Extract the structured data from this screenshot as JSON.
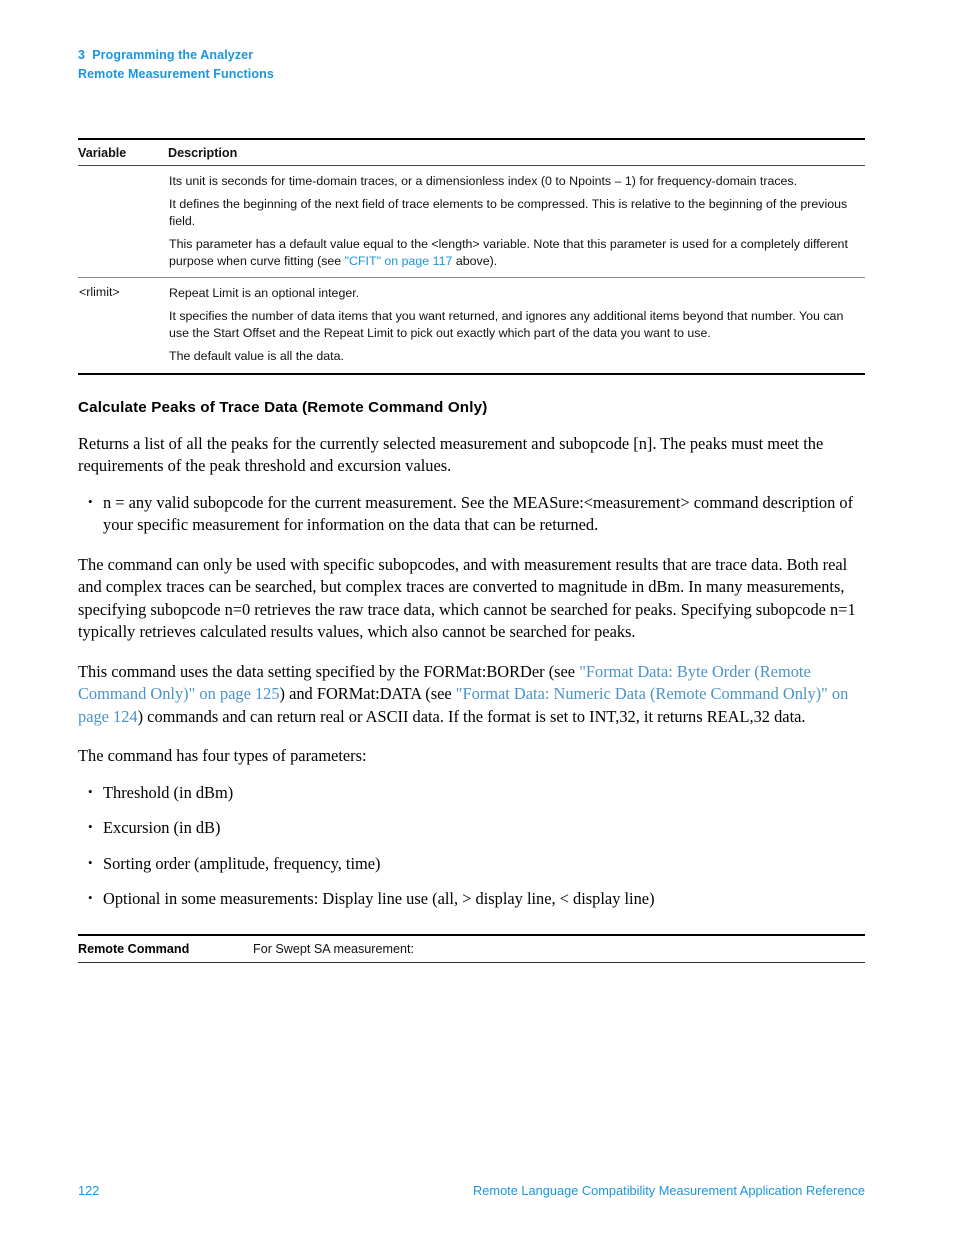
{
  "header": {
    "chapter_line": "3  Programming the Analyzer",
    "section_line": "Remote Measurement Functions"
  },
  "variable_table": {
    "columns": {
      "variable": "Variable",
      "description": "Description"
    },
    "rows": [
      {
        "variable": "",
        "paragraphs": [
          "Its unit is seconds for time-domain traces, or a dimensionless index (0 to Npoints – 1) for frequency-domain traces.",
          "It defines the beginning of the next field of trace elements to be compressed. This is relative to the beginning of the previous field."
        ],
        "link_paragraph": {
          "before": "This parameter has a default value equal to the <length> variable. Note that this parameter is used for a completely different purpose when curve fitting (see ",
          "link": "\"CFIT\" on page 117",
          "after": " above)."
        }
      },
      {
        "variable": "<rlimit>",
        "paragraphs": [
          "Repeat Limit is an optional integer.",
          "It specifies the number of data items that you want returned, and ignores any additional items beyond that number. You can use the Start Offset and the Repeat Limit to pick out exactly which part of the data you want to use.",
          "The default value is all the data."
        ]
      }
    ]
  },
  "section": {
    "heading": "Calculate Peaks of Trace Data (Remote Command Only)",
    "intro": "Returns a list of all the peaks for the currently selected measurement and subopcode [n]. The peaks must meet the requirements of the peak threshold and excursion values.",
    "intro_bullets": [
      "n = any valid subopcode for the current measurement. See the MEASure:<measurement> command description of your specific measurement for information on the data that can be returned."
    ],
    "paragraph_subopcodes": "The command can only be used with specific subopcodes, and with measurement results that are trace data. Both real and complex traces can be searched, but complex traces are converted to magnitude in dBm. In many measurements, specifying subopcode n=0 retrieves the raw trace data, which cannot be searched for peaks. Specifying subopcode n=1 typically retrieves calculated results values, which also cannot be searched for peaks.",
    "paragraph_format": {
      "part1": "This command uses the data setting specified by the FORMat:BORDer (see ",
      "link1": "\"Format Data: Byte Order (Remote Command Only)\" on page 125",
      "part2": ") and FORMat:DATA (see ",
      "link2": "\"Format Data: Numeric Data (Remote Command Only)\" on page 124",
      "part3": ") commands and can return real or ASCII data. If the format is set to INT,32, it returns REAL,32 data."
    },
    "parameters_intro": "The command has four types of parameters:",
    "parameter_bullets": [
      "Threshold (in dBm)",
      "Excursion (in dB)",
      "Sorting order (amplitude, frequency, time)",
      "Optional in some measurements: Display line use (all, > display line, < display line)"
    ]
  },
  "remote_command": {
    "label": "Remote Command",
    "value": "For Swept SA measurement:"
  },
  "footer": {
    "page_number": "122",
    "document_title": "Remote Language Compatibility Measurement Application Reference"
  },
  "colors": {
    "header_blue": "#1b96dc",
    "link_blue": "#4a93c8",
    "text_black": "#000000"
  }
}
